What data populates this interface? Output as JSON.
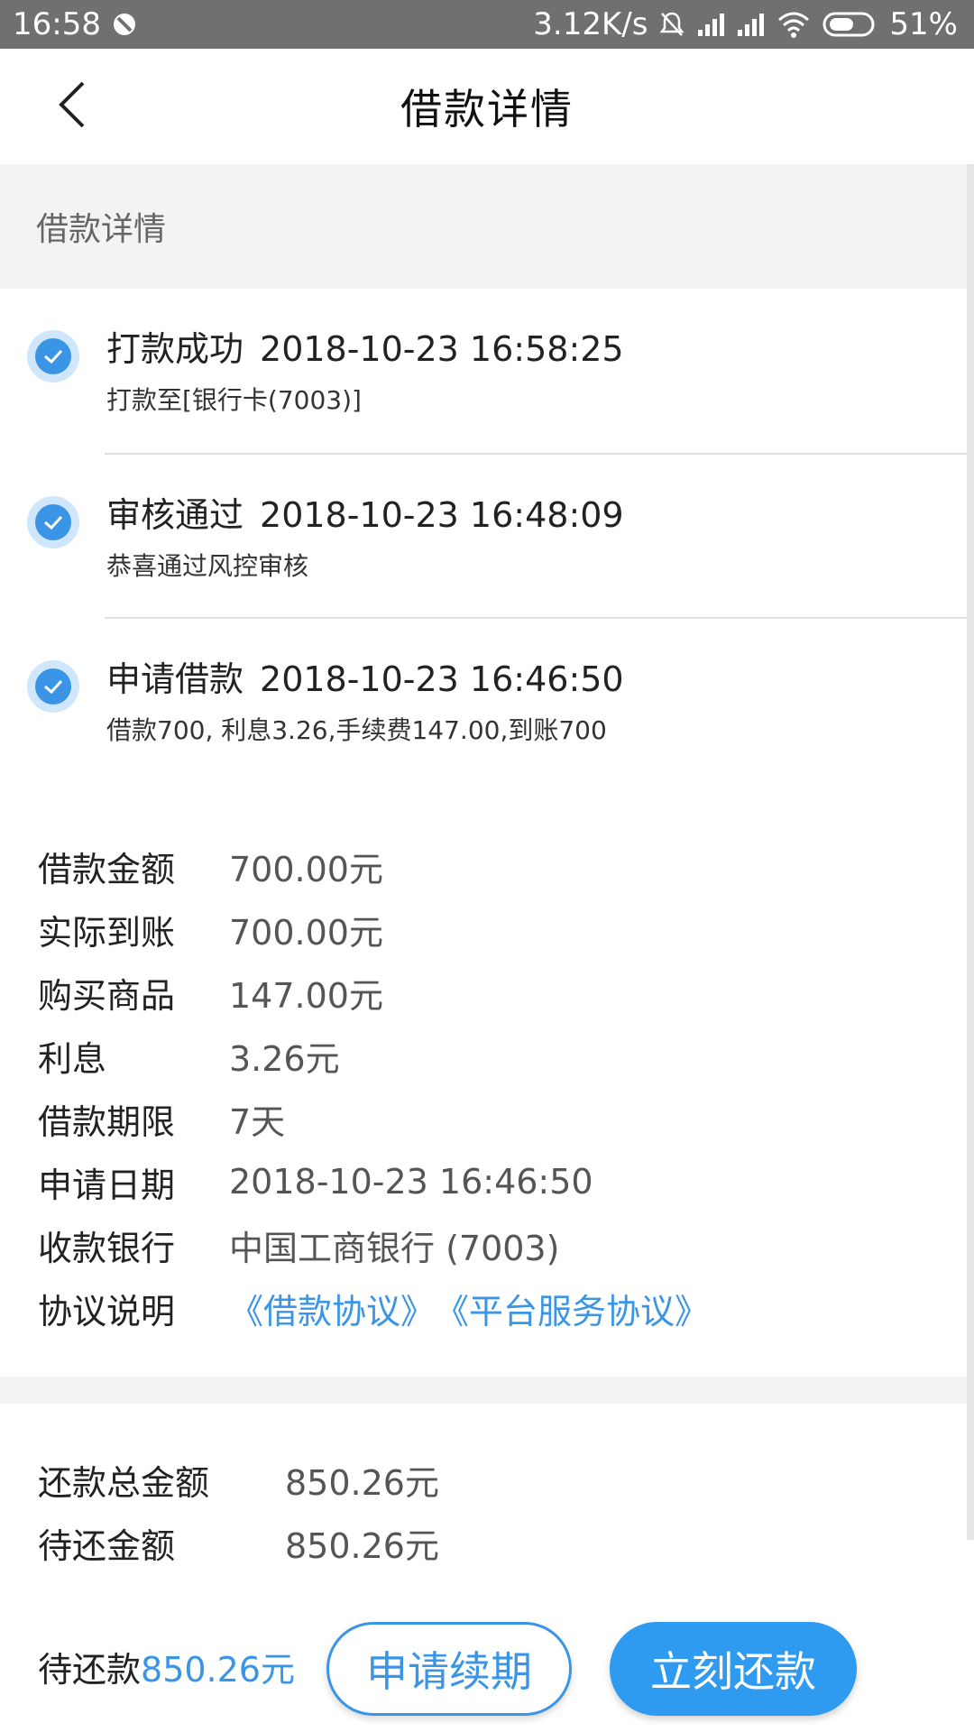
{
  "status_bar": {
    "time": "16:58",
    "speed": "3.12K/s",
    "battery": "51%",
    "icons": [
      "blocked-icon",
      "bell-mute-icon",
      "signal-icon",
      "signal-icon",
      "wifi-icon",
      "battery-icon"
    ]
  },
  "nav": {
    "title": "借款详情",
    "back_icon": "back-chevron-icon"
  },
  "section": {
    "title": "借款详情"
  },
  "timeline": [
    {
      "title": "打款成功",
      "time": "2018-10-23 16:58:25",
      "desc": "打款至[银行卡(7003)]"
    },
    {
      "title": "审核通过",
      "time": "2018-10-23 16:48:09",
      "desc": "恭喜通过风控审核"
    },
    {
      "title": "申请借款",
      "time": "2018-10-23 16:46:50",
      "desc": "借款700, 利息3.26,手续费147.00,到账700"
    }
  ],
  "details": [
    {
      "label": "借款金额",
      "value": "700.00元"
    },
    {
      "label": "实际到账",
      "value": "700.00元"
    },
    {
      "label": "购买商品",
      "value": "147.00元"
    },
    {
      "label": "利息",
      "value": "3.26元"
    },
    {
      "label": "借款期限",
      "value": "7天"
    },
    {
      "label": "申请日期",
      "value": "2018-10-23 16:46:50"
    },
    {
      "label": "收款银行",
      "value": "中国工商银行 (7003)"
    }
  ],
  "agreement": {
    "label": "协议说明",
    "loan_agreement": "《借款协议》",
    "service_agreement": "《平台服务协议》"
  },
  "summary": [
    {
      "label": "还款总金额",
      "value": "850.26元"
    },
    {
      "label": "待还金额",
      "value": "850.26元"
    }
  ],
  "bottom": {
    "due_label": "待还款",
    "due_amount": "850.26元",
    "renew_label": "申请续期",
    "repay_label": "立刻还款"
  },
  "colors": {
    "accent": "#3b95e6",
    "status_bar": "#707070",
    "section_bg": "#f3f3f3"
  }
}
